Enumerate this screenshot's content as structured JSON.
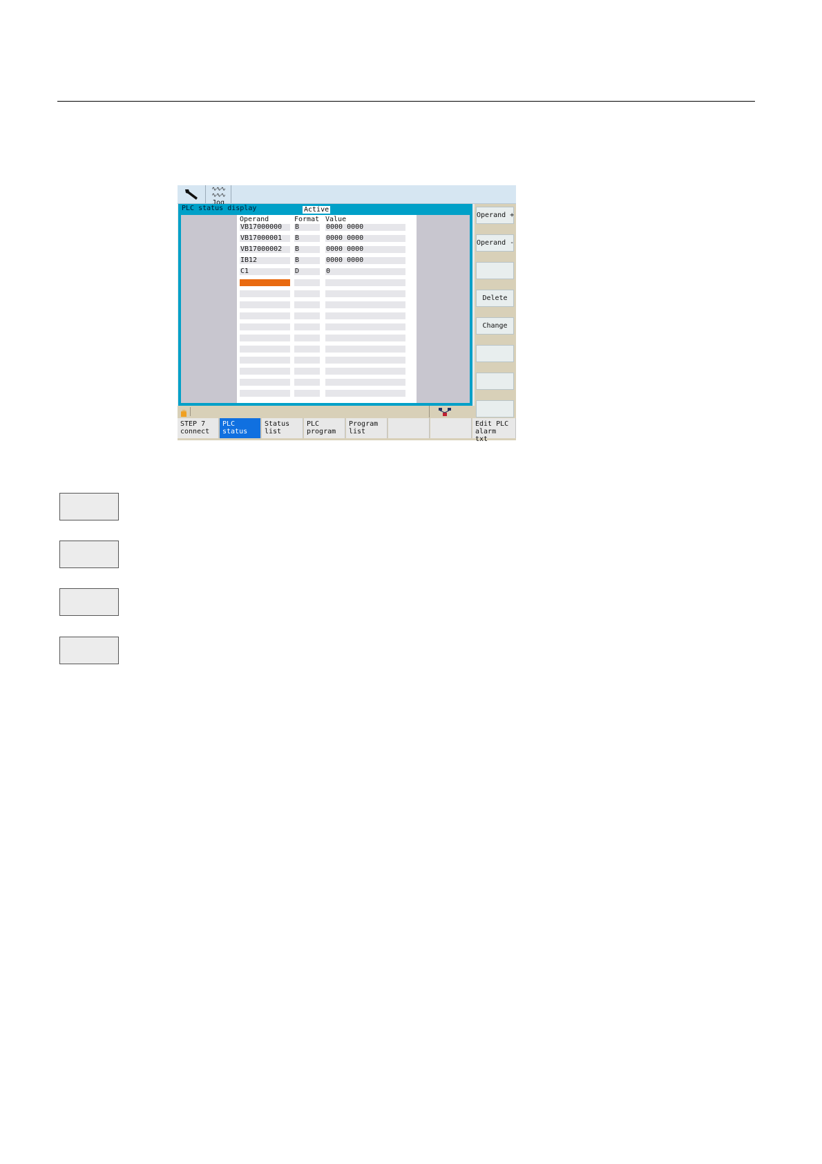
{
  "topbar": {
    "jog_label": "Jog"
  },
  "window": {
    "title": "PLC status display",
    "status": "Active",
    "columns": {
      "operand": "Operand",
      "format": "Format",
      "value": "Value"
    },
    "rows": [
      {
        "operand": "VB17000000",
        "format": "B",
        "value": "0000 0000"
      },
      {
        "operand": "VB17000001",
        "format": "B",
        "value": "0000 0000"
      },
      {
        "operand": "VB17000002",
        "format": "B",
        "value": "0000 0000"
      },
      {
        "operand": "IB12",
        "format": "B",
        "value": "0000 0000"
      },
      {
        "operand": "C1",
        "format": "D",
        "value": "0"
      }
    ]
  },
  "vertical_softkeys": [
    "Operand +",
    "Operand -",
    "",
    "Delete",
    "Change",
    "",
    "",
    ""
  ],
  "horizontal_softkeys": [
    {
      "label": "STEP 7\nconnect"
    },
    {
      "label": "PLC\nstatus"
    },
    {
      "label": "Status\nlist"
    },
    {
      "label": "PLC\nprogram"
    },
    {
      "label": "Program\nlist"
    },
    {
      "label": ""
    },
    {
      "label": ""
    },
    {
      "label": "Edit PLC\nalarm txt"
    }
  ],
  "active_horizontal_softkey": "PLC\nstatus",
  "colors": {
    "accent": "#00a0c8",
    "selected_row": "#e96a10",
    "active_softkey": "#1070e0",
    "softkey_strip": "#d8d0b8"
  },
  "icons": [
    "wrench-icon",
    "jog-wave-icon",
    "hand-icon",
    "network-icon"
  ]
}
